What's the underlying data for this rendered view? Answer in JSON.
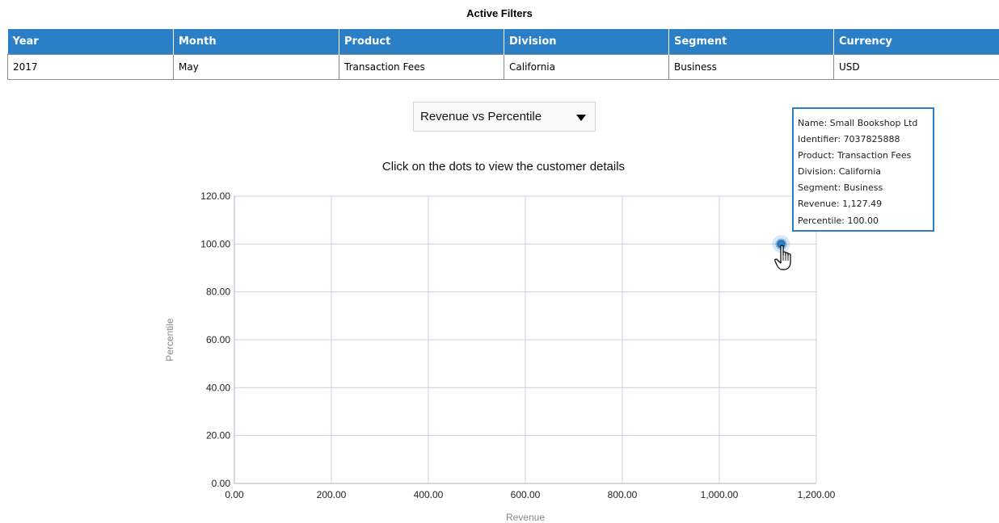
{
  "filters": {
    "title": "Active Filters",
    "headers": [
      "Year",
      "Month",
      "Product",
      "Division",
      "Segment",
      "Currency"
    ],
    "values": [
      "2017",
      "May",
      "Transaction Fees",
      "California",
      "Business",
      "USD"
    ],
    "header_color": "#2a7fc6"
  },
  "selector": {
    "selected": "Revenue vs Percentile",
    "caret_icon": "triangle-down-icon"
  },
  "instruction": "Click on the dots to view the customer details",
  "tooltip": {
    "name_line": "Name: Small Bookshop Ltd",
    "identifier_line": "Identifier: 7037825888",
    "product_line": "Product: Transaction Fees",
    "division_line": "Division: California",
    "segment_line": "Segment: Business",
    "revenue_line": "Revenue: 1,127.49",
    "percentile_line": "Percentile: 100.00"
  },
  "chart_data": {
    "type": "scatter",
    "title": "",
    "xlabel": "Revenue",
    "ylabel": "Percentile",
    "xlim": [
      0,
      1200
    ],
    "ylim": [
      0,
      120
    ],
    "x_ticks": [
      "0.00",
      "200.00",
      "400.00",
      "600.00",
      "800.00",
      "1,000.00",
      "1,200.00"
    ],
    "y_ticks": [
      "0.00",
      "20.00",
      "40.00",
      "60.00",
      "80.00",
      "100.00",
      "120.00"
    ],
    "grid": true,
    "points": [
      {
        "x": 1127.49,
        "y": 100.0
      }
    ],
    "point_color": "#2a7fc6",
    "grid_color": "#c8d2dc"
  },
  "cursor_icon": "hand-pointer-icon"
}
